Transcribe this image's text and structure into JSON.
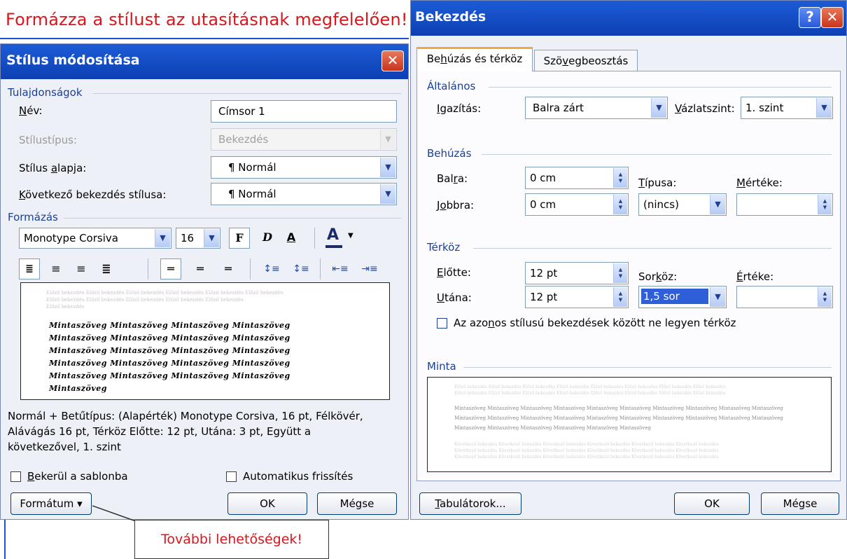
{
  "instruction": "Formázza a stílust az utasításnak megfelelően!",
  "callout": "További lehetőségek!",
  "left_dialog": {
    "title": "Stílus módosítása",
    "properties_section": "Tulajdonságok",
    "name_label": "Név:",
    "name_value": "Címsor 1",
    "style_type_label": "Stílustípus:",
    "style_type_value": "Bekezdés",
    "based_on_label": "Stílus alapja:",
    "based_on_value": "¶ Normál",
    "next_style_label": "Következő bekezdés stílusa:",
    "next_style_value": "¶ Normál",
    "format_section": "Formázás",
    "font_value": "Monotype Corsiva",
    "size_value": "16",
    "bold_label": "F",
    "italic_label": "D",
    "underline_label": "A",
    "font_color_label": "A",
    "sample_lines": [
      "Mintaszöveg Mintaszöveg Mintaszöveg Mintaszöveg",
      "Mintaszöveg Mintaszöveg Mintaszöveg Mintaszöveg",
      "Mintaszöveg Mintaszöveg Mintaszöveg Mintaszöveg",
      "Mintaszöveg Mintaszöveg Mintaszöveg Mintaszöveg",
      "Mintaszöveg Mintaszöveg Mintaszöveg Mintaszöveg",
      "Mintaszöveg"
    ],
    "description": [
      "Normál + Betűtípus: (Alapérték) Monotype Corsiva, 16 pt, Félkövér,",
      "Alávágás 16 pt, Térköz Előtte:  12 pt, Utána:  3 pt, Együtt a",
      "következővel, 1. szint"
    ],
    "add_to_template_label": "Bekerül a sablonba",
    "auto_update_label": "Automatikus frissítés",
    "format_button": "Formátum ▾",
    "ok_button": "OK",
    "cancel_button": "Mégse"
  },
  "right_dialog": {
    "title": "Bekezdés",
    "help_label": "?",
    "close_label": "X",
    "tabs": [
      "Behúzás és térköz",
      "Szövegbeosztás"
    ],
    "general_section": "Általános",
    "alignment_label": "Igazítás:",
    "alignment_value": "Balra zárt",
    "outline_label": "Vázlatszint:",
    "outline_value": "1. szint",
    "indent_section": "Behúzás",
    "left_label": "Balra:",
    "left_value": "0 cm",
    "right_label": "Jobbra:",
    "right_value": "0 cm",
    "special_label": "Típusa:",
    "special_value": "(nincs)",
    "by_label": "Mértéke:",
    "by_value": "",
    "spacing_section": "Térköz",
    "before_label": "Előtte:",
    "before_value": "12 pt",
    "after_label": "Utána:",
    "after_value": "12 pt",
    "line_spacing_label": "Sorköz:",
    "line_spacing_value": "1,5 sor",
    "at_label": "Értéke:",
    "at_value": "",
    "no_space_label": "Az azonos stílusú bekezdések között ne legyen térköz",
    "preview_section": "Minta",
    "preview_lines": [
      "Mintaszöveg Mintaszöveg Mintaszöveg Mintaszöveg Mintaszöveg Mintaszöveg Mintaszöveg Mintaszöveg Mintaszöveg Mintaszöveg",
      "Mintaszöveg Mintaszöveg Mintaszöveg Mintaszöveg Mintaszöveg Mintaszöveg Mintaszöveg Mintaszöveg Mintaszöveg Mintaszöveg",
      "Mintaszöveg Mintaszöveg Mintaszöveg Mintaszöveg Mintaszöveg Mintaszöveg"
    ],
    "tabs_button": "Tabulátorok...",
    "ok_button": "OK",
    "cancel_button": "Mégse"
  }
}
